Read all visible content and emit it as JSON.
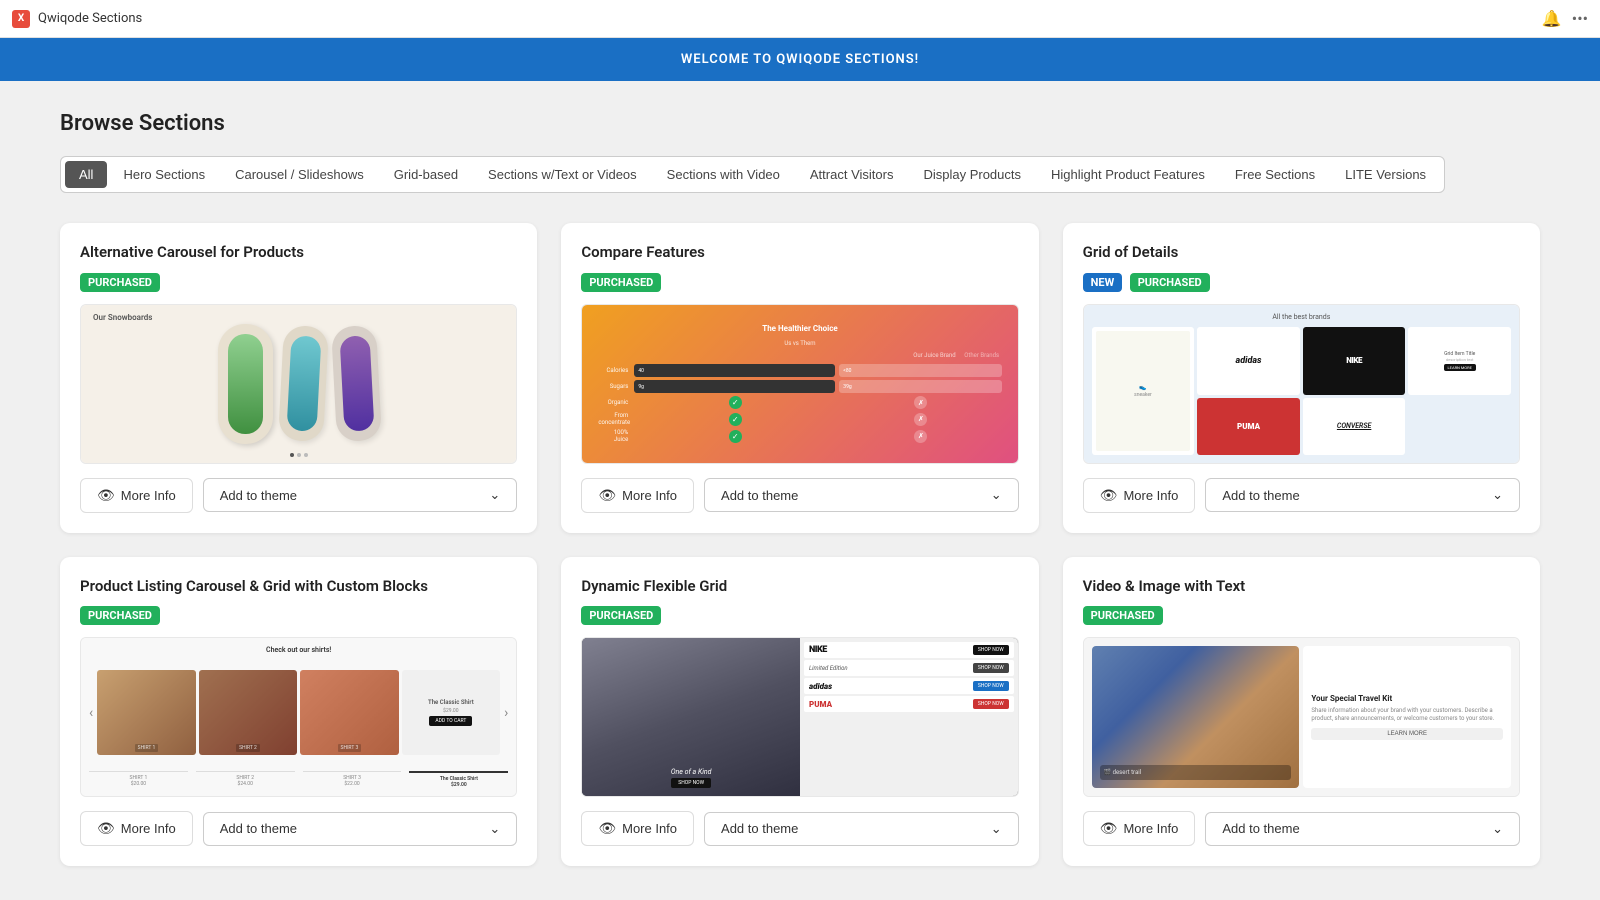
{
  "titlebar": {
    "app_name": "Qwiqode Sections",
    "logo_letter": "X"
  },
  "welcome_banner": {
    "text": "WELCOME TO QWIQODE SECTIONS!"
  },
  "browse": {
    "title": "Browse Sections"
  },
  "filter_tabs": [
    {
      "id": "all",
      "label": "All",
      "active": true
    },
    {
      "id": "hero",
      "label": "Hero Sections",
      "active": false
    },
    {
      "id": "carousel",
      "label": "Carousel / Slideshows",
      "active": false
    },
    {
      "id": "grid",
      "label": "Grid-based",
      "active": false
    },
    {
      "id": "text-videos",
      "label": "Sections w/Text or Videos",
      "active": false
    },
    {
      "id": "video",
      "label": "Sections with Video",
      "active": false
    },
    {
      "id": "attract",
      "label": "Attract Visitors",
      "active": false
    },
    {
      "id": "display",
      "label": "Display Products",
      "active": false
    },
    {
      "id": "highlight",
      "label": "Highlight Product Features",
      "active": false
    },
    {
      "id": "free",
      "label": "Free Sections",
      "active": false
    },
    {
      "id": "lite",
      "label": "LITE Versions",
      "active": false
    }
  ],
  "cards": [
    {
      "id": "card-1",
      "title": "Alternative Carousel for Products",
      "badge_purchased": true,
      "badge_new": false,
      "more_info_label": "More Info",
      "add_theme_label": "Add to theme"
    },
    {
      "id": "card-2",
      "title": "Compare Features",
      "badge_purchased": true,
      "badge_new": false,
      "more_info_label": "More Info",
      "add_theme_label": "Add to theme"
    },
    {
      "id": "card-3",
      "title": "Grid of Details",
      "badge_purchased": true,
      "badge_new": true,
      "more_info_label": "More Info",
      "add_theme_label": "Add to theme"
    },
    {
      "id": "card-4",
      "title": "Product Listing Carousel & Grid with Custom Blocks",
      "badge_purchased": true,
      "badge_new": false,
      "more_info_label": "More Info",
      "add_theme_label": "Add to theme"
    },
    {
      "id": "card-5",
      "title": "Dynamic Flexible Grid",
      "badge_purchased": true,
      "badge_new": false,
      "more_info_label": "More Info",
      "add_theme_label": "Add to theme"
    },
    {
      "id": "card-6",
      "title": "Video & Image with Text",
      "badge_purchased": true,
      "badge_new": false,
      "more_info_label": "More Info",
      "add_theme_label": "Add to theme"
    }
  ],
  "badges": {
    "purchased": "PURCHASED",
    "new": "NEW"
  },
  "compare_rows": [
    {
      "label": "Our Juice Brand",
      "category": "Calories",
      "ours": "40",
      "theirs": "<80"
    },
    {
      "label": "",
      "category": "Sugars",
      "ours": "9g",
      "theirs": "39g"
    },
    {
      "label": "",
      "category": "Organic",
      "ours": "✓",
      "theirs": "✗"
    },
    {
      "label": "",
      "category": "From concentrate",
      "ours": "✓",
      "theirs": "✗"
    },
    {
      "label": "",
      "category": "100% Juice",
      "ours": "✓",
      "theirs": "✗"
    }
  ],
  "brands": [
    "converse",
    "adidas",
    "NIKE",
    "PUMA",
    "converse"
  ],
  "video_preview": {
    "title": "Your Special Travel Kit",
    "description": "Share information about your brand with your customers. Describe a product, share announcements, or welcome customers to your store.",
    "btn_label": "LEARN MORE"
  }
}
